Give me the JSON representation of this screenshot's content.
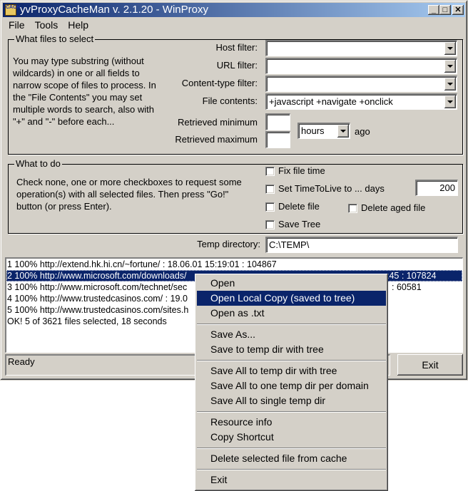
{
  "window": {
    "title": "yvProxyCacheMan v. 2.1.20 - WinProxy",
    "app_icon_text": "CACH",
    "controls": {
      "minimize": "_",
      "maximize": "□",
      "close": "✕"
    }
  },
  "menubar": [
    "File",
    "Tools",
    "Help"
  ],
  "select_group": {
    "label": "What files to select",
    "help_text": "You may type substring (without wildcards) in one or all fields to narrow scope of files to process. In the \"File Contents\" you may set multiple words to search, also with \"+\" and \"-\" before each...",
    "host_filter": {
      "label": "Host filter:",
      "value": ""
    },
    "url_filter": {
      "label": "URL filter:",
      "value": ""
    },
    "content_type_filter": {
      "label": "Content-type filter:",
      "value": ""
    },
    "file_contents": {
      "label": "File contents:",
      "value": "+javascript +navigate +onclick"
    },
    "retrieved_min": {
      "label": "Retrieved minimum",
      "value": ""
    },
    "retrieved_max": {
      "label": "Retrieved maximum",
      "value": ""
    },
    "time_unit": {
      "value": "hours",
      "suffix": "ago"
    }
  },
  "todo_group": {
    "label": "What to do",
    "help_text": "Check none, one or more checkboxes to request some operation(s) with all selected files. Then press \"Go!\" button (or press Enter).",
    "options": {
      "fix_file_time": {
        "label": "Fix file time",
        "checked": false
      },
      "set_ttl": {
        "label": "Set TimeToLive to ... days",
        "checked": false,
        "days": "200"
      },
      "delete_file": {
        "label": "Delete file",
        "checked": false
      },
      "delete_aged": {
        "label": "Delete aged file",
        "checked": false
      },
      "save_tree": {
        "label": "Save Tree",
        "checked": false
      }
    }
  },
  "temp_dir": {
    "label": "Temp directory:",
    "value": "C:\\TEMP\\"
  },
  "results": [
    {
      "text": "1 100% http://extend.hk.hi.cn/~fortune/ : 18.06.01 15:19:01 : 104867",
      "selected": false
    },
    {
      "text": "2 100% http://www.microsoft.com/downloads/",
      "tail": ":45 : 107824",
      "selected": true
    },
    {
      "text": "3 100% http://www.microsoft.com/technet/sec",
      "tail": ": 60581",
      "selected": false
    },
    {
      "text": "4 100% http://www.trustedcasinos.com/ : 19.0",
      "selected": false
    },
    {
      "text": "5 100% http://www.trustedcasinos.com/sites.h",
      "selected": false
    },
    {
      "text": "OK! 5 of 3621 files selected, 18 seconds",
      "selected": false
    }
  ],
  "status": "Ready",
  "buttons": {
    "exit": "Exit"
  },
  "context_menu": {
    "items": [
      {
        "label": "Open"
      },
      {
        "label": "Open Local Copy (saved to tree)",
        "highlighted": true
      },
      {
        "label": "Open as .txt"
      },
      {
        "label": "Save As..."
      },
      {
        "label": "Save to temp dir with tree"
      },
      {
        "label": "Save All to temp dir with tree"
      },
      {
        "label": "Save All to one temp dir per domain"
      },
      {
        "label": "Save All to single temp dir"
      },
      {
        "label": "Resource info"
      },
      {
        "label": "Copy Shortcut"
      },
      {
        "label": "Delete selected file from cache"
      },
      {
        "label": "Exit"
      }
    ]
  }
}
